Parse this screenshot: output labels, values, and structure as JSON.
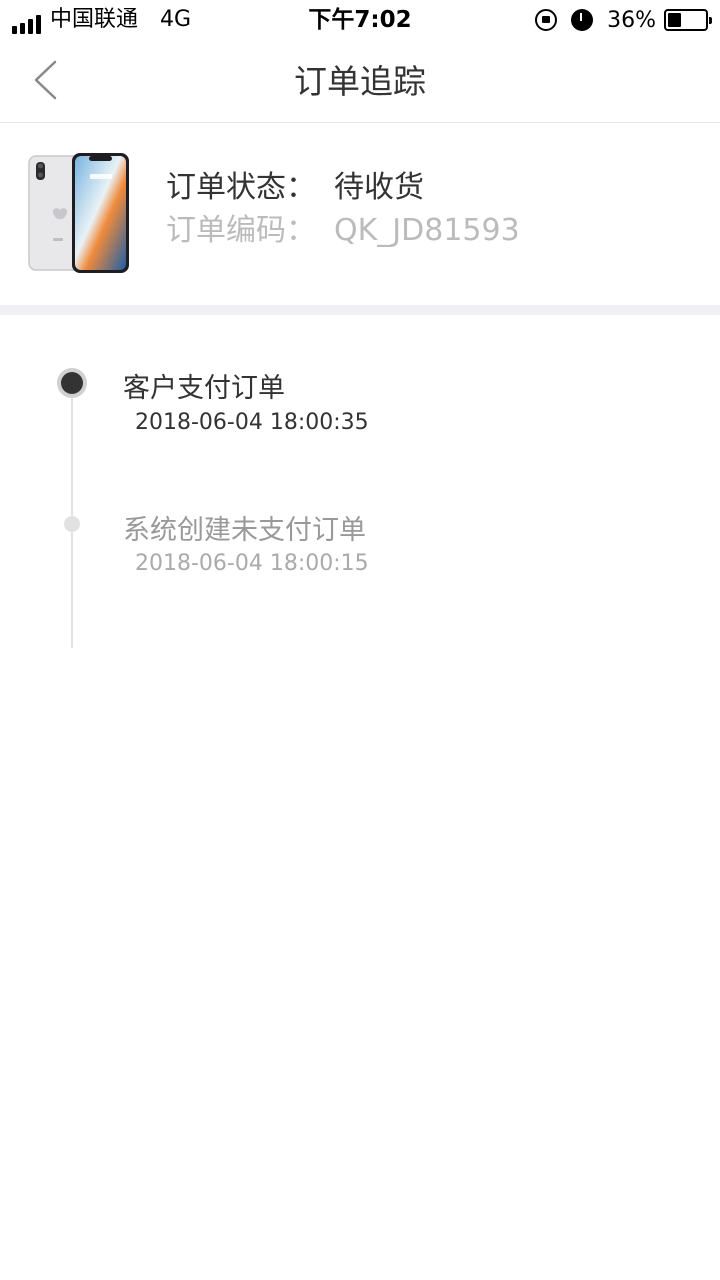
{
  "status_bar": {
    "carrier": "中国联通",
    "network": "4G",
    "time": "下午7:02",
    "battery_percent": "36%",
    "battery_level": 0.36,
    "icons": [
      "signal-icon",
      "rotation-lock-icon",
      "alarm-icon",
      "battery-icon"
    ]
  },
  "nav": {
    "title": "订单追踪",
    "back_icon": "chevron-left-icon"
  },
  "order": {
    "status_label": "订单状态：",
    "status_value": "待收货",
    "code_label": "订单编码：",
    "code_value": "QK_JD81593"
  },
  "timeline": [
    {
      "title": "客户支付订单",
      "time": "2018-06-04 18:00:35",
      "active": true
    },
    {
      "title": "系统创建未支付订单",
      "time": "2018-06-04 18:00:15",
      "active": false
    }
  ],
  "colors": {
    "primary_text": "#333333",
    "secondary_text": "#bbbbbb",
    "divider": "#f0eff4",
    "timeline_line": "#e2e2e2"
  }
}
